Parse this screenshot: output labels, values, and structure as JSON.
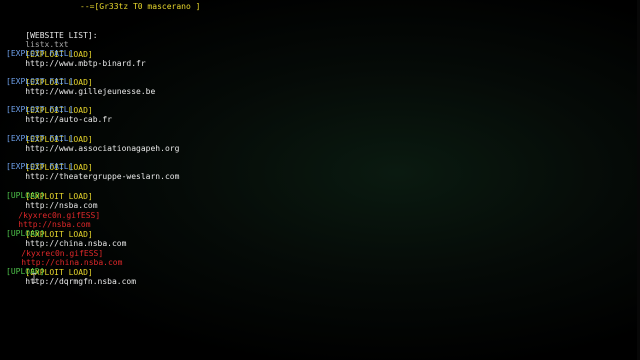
{
  "colors": {
    "background": "#000000",
    "white": "#e8e8e8",
    "yellow": "#e7d62c",
    "blue": "#6ea0ea",
    "green": "#4ec24a",
    "red": "#e0282a",
    "gray": "#a9a9a9"
  },
  "banner": {
    "text": "--=[Gr33tz T0 mascerano ]"
  },
  "website_list": {
    "label": "[WEBSITE LIST]:",
    "file": "listx.txt"
  },
  "entries": [
    {
      "load_tag": "[EXPLOIT LOAD]",
      "url": "http://www.mbtp-binard.fr",
      "result": "[EXPLOIT FAIL]",
      "result_type": "fail"
    },
    {
      "load_tag": "[EXPLOIT LOAD]",
      "url": "http://www.gillejeunesse.be",
      "result": "[EXPLOIT FAIL]",
      "result_type": "fail"
    },
    {
      "load_tag": "[EXPLOIT LOAD]",
      "url": "http://auto-cab.fr",
      "result": "[EXPLOIT FAIL]",
      "result_type": "fail"
    },
    {
      "load_tag": "[EXPLOIT LOAD]",
      "url": "http://www.associationagapeh.org",
      "result": "[EXPLOIT FAIL]",
      "result_type": "fail"
    },
    {
      "load_tag": "[EXPLOIT LOAD]",
      "url": "http://theatergruppe-weslarn.com",
      "result": "[EXPLOIT FAIL]",
      "result_type": "fail"
    },
    {
      "load_tag": "[EXPLOIT LOAD]",
      "url": "http://nsba.com",
      "result": "[UPLOAD]",
      "result_type": "upload",
      "shell_path": "/kyxrec0n.gifESS]",
      "shell_url": "http://nsba.com"
    },
    {
      "load_tag": "[EXPLOIT LOAD]",
      "url": "http://china.nsba.com",
      "result": "[UPLOAD]",
      "result_type": "upload",
      "shell_path": "/kyxrec0n.gifESS]",
      "shell_url": "http://china.nsba.com"
    },
    {
      "load_tag": "[EXPLOIT LOAD]",
      "url": "http://dqrmgfn.nsba.com",
      "result": "[UPLOAD]",
      "result_type": "upload"
    }
  ],
  "icons": {
    "cursor": "text-cursor-icon"
  }
}
